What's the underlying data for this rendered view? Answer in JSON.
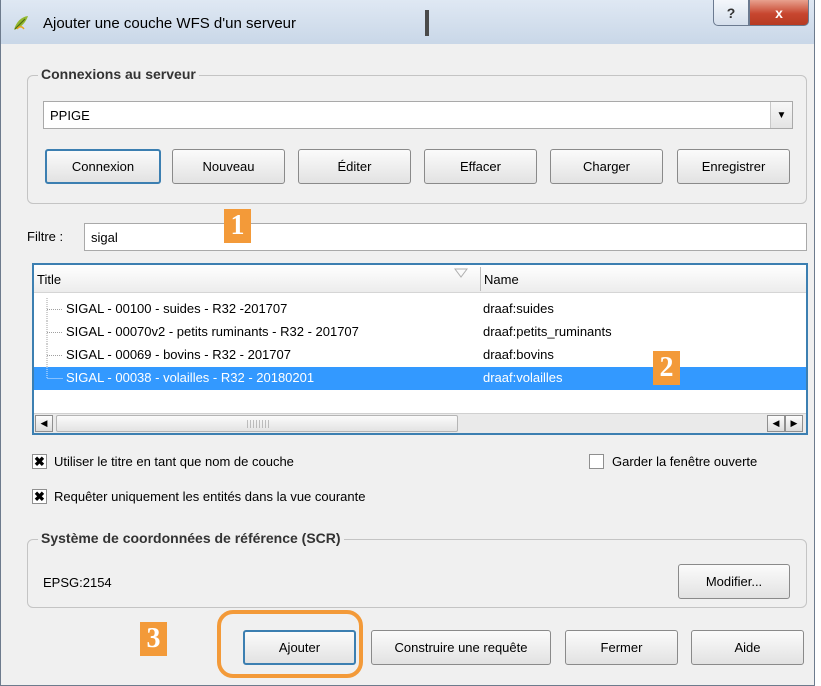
{
  "window": {
    "title": "Ajouter une couche WFS d'un serveur",
    "help_label": "?",
    "close_label": "x"
  },
  "connections": {
    "group_title": "Connexions au serveur",
    "selected": "PPIGE",
    "buttons": {
      "connect": "Connexion",
      "new": "Nouveau",
      "edit": "Éditer",
      "delete": "Effacer",
      "load": "Charger",
      "save": "Enregistrer"
    }
  },
  "filter": {
    "label": "Filtre :",
    "value": "sigal"
  },
  "markers": {
    "one": "1",
    "two": "2",
    "three": "3"
  },
  "layers": {
    "columns": {
      "title": "Title",
      "name": "Name"
    },
    "rows": [
      {
        "title": "SIGAL - 00100 - suides - R32  -201707",
        "name": "draaf:suides"
      },
      {
        "title": "SIGAL - 00070v2 - petits ruminants - R32 - 201707",
        "name": "draaf:petits_ruminants"
      },
      {
        "title": "SIGAL - 00069 - bovins - R32 - 201707",
        "name": "draaf:bovins"
      },
      {
        "title": "SIGAL - 00038 - volailles - R32 - 20180201",
        "name": "draaf:volailles"
      }
    ],
    "selected_index": 3
  },
  "options": {
    "use_title": {
      "label": "Utiliser le titre en tant que nom de couche",
      "checked": true
    },
    "keep_open": {
      "label": "Garder la fenêtre ouverte",
      "checked": false
    },
    "current_view": {
      "label": "Requêter uniquement les entités dans la vue courante",
      "checked": true
    }
  },
  "crs": {
    "group_title": "Système de coordonnées de référence (SCR)",
    "value": "EPSG:2154",
    "modify_label": "Modifier..."
  },
  "footer": {
    "add": "Ajouter",
    "build_query": "Construire une requête",
    "close": "Fermer",
    "help": "Aide"
  },
  "colors": {
    "accent": "#3399ff",
    "marker": "#f39a39",
    "close_button": "#c7462f"
  }
}
